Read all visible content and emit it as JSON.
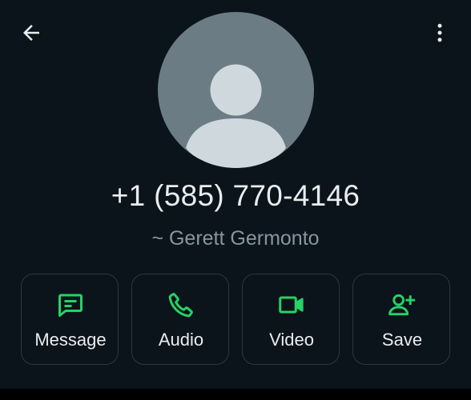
{
  "header": {
    "back_icon": "arrow-left-icon",
    "menu_icon": "more-vert-icon"
  },
  "contact": {
    "avatar_icon": "default-avatar-icon",
    "phone": "+1 (585) 770-4146",
    "display_name": "~ Gerett Germonto"
  },
  "actions": [
    {
      "label": "Message",
      "icon": "message-icon"
    },
    {
      "label": "Audio",
      "icon": "phone-icon"
    },
    {
      "label": "Video",
      "icon": "video-icon"
    },
    {
      "label": "Save",
      "icon": "add-person-icon"
    }
  ],
  "colors": {
    "background": "#0b141a",
    "accent": "#25d366",
    "text_primary": "#e9edef",
    "text_secondary": "#8696a0",
    "avatar_bg": "#6b7c85",
    "avatar_fg": "#cfd8dc"
  }
}
